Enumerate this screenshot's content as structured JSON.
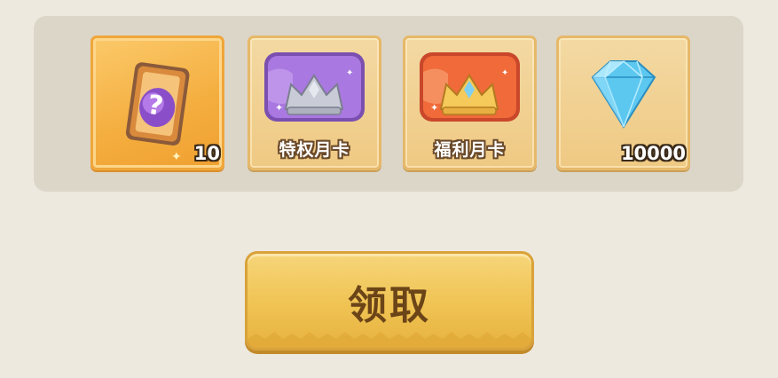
{
  "rewards": [
    {
      "name": "mystery card",
      "quantity": "10",
      "selected": true
    },
    {
      "name": "privilege monthly card",
      "label": "特权月卡"
    },
    {
      "name": "welfare monthly card",
      "label": "福利月卡"
    },
    {
      "name": "diamond",
      "quantity": "10000"
    }
  ],
  "claim_button": {
    "label": "领取"
  },
  "colors": {
    "background": "#ede9df",
    "tray": "#dcd6c9",
    "slot": "#efc983",
    "slot_selected": "#f4ad3e",
    "privilege_card": "#a978e0",
    "welfare_card": "#f06a3a",
    "diamond": "#5cc8f0",
    "button": "#f0c352",
    "button_text": "#6b4418"
  }
}
